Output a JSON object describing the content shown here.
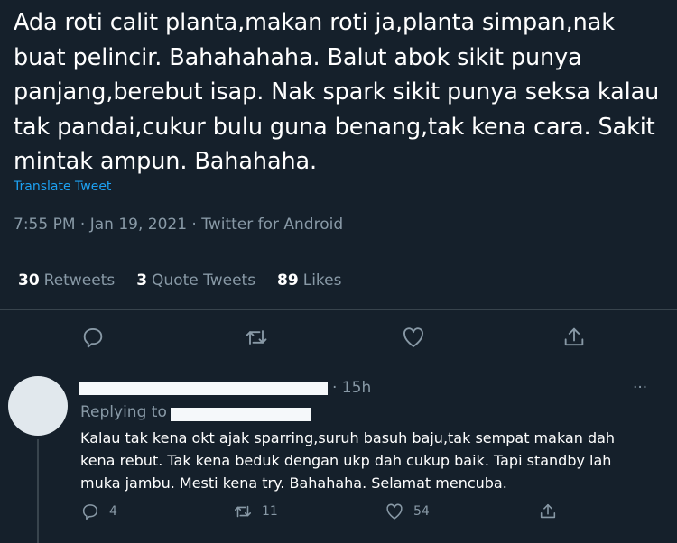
{
  "tweet": {
    "text": "Ada roti calit planta,makan roti ja,planta simpan,nak\nbuat pelincir. Bahahahaha. Balut abok sikit punya\npanjang,berebut isap. Nak spark sikit punya seksa kalau\ntak pandai,cukur bulu guna benang,tak kena cara. Sakit\nmintak ampun. Bahahaha.",
    "translate_label": "Translate Tweet",
    "meta": "7:55 PM · Jan 19, 2021 · Twitter for Android"
  },
  "stats": {
    "retweets_count": "30",
    "retweets_label": "Retweets",
    "quotes_count": "3",
    "quotes_label": "Quote Tweets",
    "likes_count": "89",
    "likes_label": "Likes"
  },
  "actions": [
    "reply-icon",
    "retweet-icon",
    "like-icon",
    "share-icon"
  ],
  "reply": {
    "time": "· 15h",
    "more": "···",
    "replying_to": "Replying to",
    "text": "Kalau tak kena okt ajak sparring,suruh basuh baju,tak sempat makan dah\nkena rebut. Tak kena beduk dengan ukp dah cukup baik. Tapi standby lah\nmuka jambu. Mesti kena try. Bahahaha. Selamat mencuba.",
    "reply_count": "4",
    "retweet_count": "11",
    "like_count": "54"
  },
  "colors": {
    "background": "#15202b",
    "secondary_text": "#8899a6",
    "link": "#1da1f2",
    "divider": "#38444d"
  }
}
